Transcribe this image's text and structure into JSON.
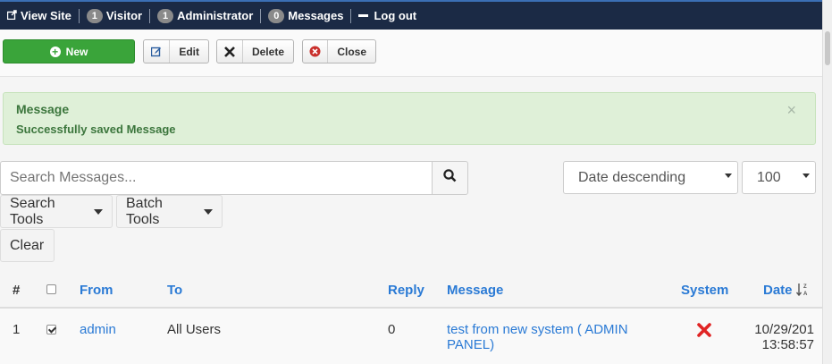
{
  "topbar": {
    "view_site": "View Site",
    "visitor": {
      "count": "1",
      "label": "Visitor"
    },
    "administrator": {
      "count": "1",
      "label": "Administrator"
    },
    "messages": {
      "count": "0",
      "label": "Messages"
    },
    "logout": "Log out"
  },
  "toolbar": {
    "new_label": "New",
    "edit_label": "Edit",
    "delete_label": "Delete",
    "close_label": "Close"
  },
  "alert": {
    "heading": "Message",
    "text": "Successfully saved Message",
    "close_glyph": "×"
  },
  "filters": {
    "search_placeholder": "Search Messages...",
    "ordering": "Date descending",
    "limit": "100",
    "search_tools": "Search Tools",
    "batch_tools": "Batch Tools",
    "clear": "Clear"
  },
  "table": {
    "headers": {
      "num": "#",
      "from": "From",
      "to": "To",
      "reply": "Reply",
      "message": "Message",
      "system": "System",
      "date": "Date"
    },
    "rows": [
      {
        "num": "1",
        "checked": true,
        "from": "admin",
        "to": "All Users",
        "reply": "0",
        "message_line1": "test from new system ( ADMIN",
        "message_line2": "PANEL)",
        "system": "no",
        "date_line1": "10/29/201",
        "date_line2": "13:58:57"
      }
    ]
  },
  "colors": {
    "topbar_bg": "#1b2a45",
    "new_button": "#3aa43a",
    "alert_bg": "#dff0d8",
    "link": "#2a7ad5",
    "system_no": "#e02424"
  }
}
